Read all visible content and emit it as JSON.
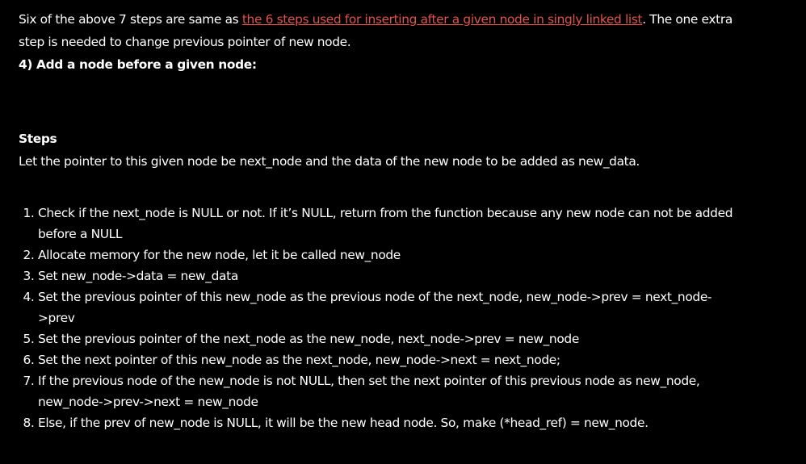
{
  "paragraph": {
    "text_before": "Six of the above 7 steps are same as ",
    "link": "the 6 steps used for inserting after a given node in singly linked list",
    "text_after": ". The one extra step is needed to change previous pointer of new node."
  },
  "section_heading": "4) Add a node before a given node:",
  "steps_heading": "Steps",
  "intro": "Let the pointer to this given node be next_node and the data of the new node to be added as new_data.",
  "steps": [
    "Check if the next_node is NULL or not. If it’s NULL, return from the function because any new node can not be added before a NULL",
    "Allocate memory for the new node, let it be called new_node",
    "Set new_node->data = new_data",
    "Set the previous pointer of this new_node as the previous node of the next_node, new_node->prev = next_node->prev",
    "Set the previous pointer of the next_node as the new_node, next_node->prev = new_node",
    "Set the next pointer of this new_node as the next_node, new_node->next = next_node;",
    "If the previous node of the new_node is not NULL, then set the next pointer of this previous node as new_node, new_node->prev->next = new_node",
    "Else, if the prev of new_node is NULL, it will be the new head node. So, make (*head_ref) = new_node."
  ],
  "colors": {
    "background": "#000000",
    "text": "#ffffff",
    "link": "#e0534a"
  }
}
